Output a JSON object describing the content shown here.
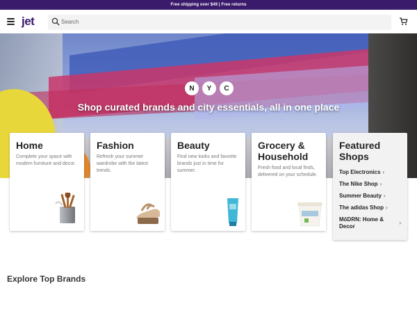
{
  "promo": {
    "text": "Free shipping over $49 | Free returns"
  },
  "header": {
    "logo": "jet",
    "search_placeholder": "Search",
    "icons": [
      "hamburger-icon",
      "search-icon",
      "cart-icon"
    ]
  },
  "hero": {
    "nyc_letters": [
      "N",
      "Y",
      "C"
    ],
    "title": "Shop curated brands and city essentials, all in one place"
  },
  "categories": [
    {
      "title": "Home",
      "description": "Complete your space with modern furniture and decor."
    },
    {
      "title": "Fashion",
      "description": "Refresh your summer wardrobe with the latest trends."
    },
    {
      "title": "Beauty",
      "description": "Find new looks and favorite brands just in time for summer."
    },
    {
      "title": "Grocery & Household",
      "description": "Fresh food and local finds, delivered on your schedule."
    }
  ],
  "featured": {
    "title": "Featured Shops",
    "items": [
      {
        "label": "Top Electronics"
      },
      {
        "label": "The Nike Shop"
      },
      {
        "label": "Summer Beauty"
      },
      {
        "label": "The adidas Shop"
      },
      {
        "label": "MōDRN: Home & Decor"
      }
    ],
    "chevron": "›"
  },
  "explore": {
    "title": "Explore Top Brands"
  },
  "colors": {
    "brand": "#3a1a6b",
    "promo_bg": "#3a1a6b"
  }
}
